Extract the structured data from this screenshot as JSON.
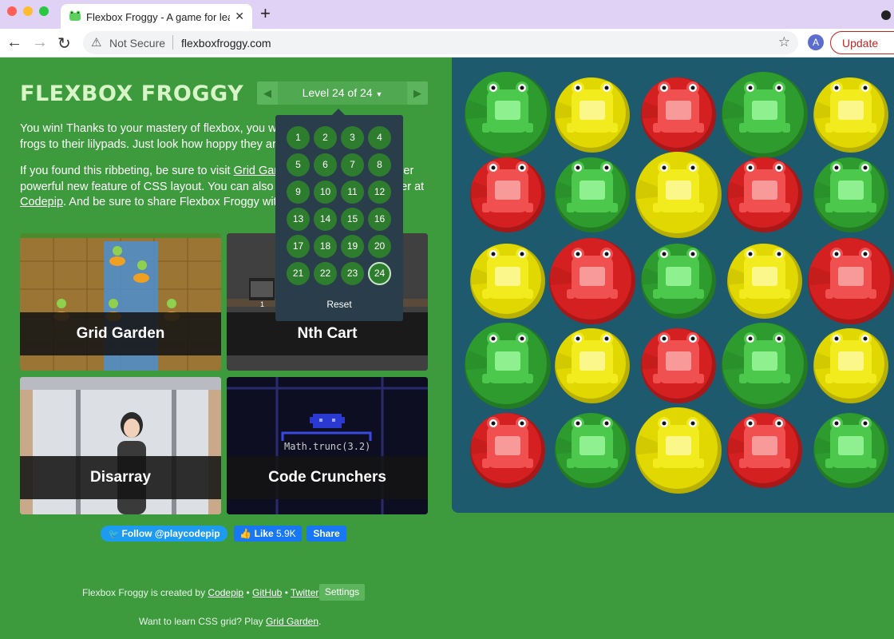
{
  "browser": {
    "tab_title": "Flexbox Froggy - A game for learning CSS flexbox",
    "address_warning": "Not Secure",
    "url": "flexboxfroggy.com",
    "avatar_letter": "A",
    "update_label": "Update"
  },
  "game": {
    "logo": "FLEXBOX FROGGY",
    "level_indicator": "Level 24 of 24",
    "win_text": {
      "p1": "You win! Thanks to your mastery of flexbox, you were able to help all of the frogs to their lilypads. Just look how hoppy they are!",
      "p2_a": "If you found this ribbeting, be sure to visit ",
      "p2_link1": "Grid Garden",
      "p2_b": " to learn about another powerful new feature of CSS layout. You can also find more of our work over at ",
      "p2_link2": "Codepip",
      "p2_c": ". And be sure to share Flexbox Froggy with your friends!"
    },
    "levels": [
      "1",
      "2",
      "3",
      "4",
      "5",
      "6",
      "7",
      "8",
      "9",
      "10",
      "11",
      "12",
      "13",
      "14",
      "15",
      "16",
      "17",
      "18",
      "19",
      "20",
      "21",
      "22",
      "23",
      "24"
    ],
    "current_level": "24",
    "reset_label": "Reset",
    "cards": [
      "Grid Garden",
      "Nth Cart",
      "Disarray",
      "Code Crunchers"
    ],
    "card_sublabels": {
      "cart_number": "1",
      "crunchers_code": "Math.trunc(3.2)"
    },
    "social": {
      "follow": "Follow @playcodepip",
      "like": "Like",
      "like_count": "5.9K",
      "share": "Share"
    },
    "footer": {
      "created_by": "Flexbox Froggy is created by ",
      "codepip": "Codepip",
      "github": "GitHub",
      "twitter": "Twitter",
      "bullet": "•",
      "settings": "Settings",
      "grid_prompt": "Want to learn CSS grid? Play ",
      "grid_link": "Grid Garden",
      "period": "."
    },
    "board_rows": [
      [
        "green",
        "yellow",
        "red",
        "green",
        "yellow"
      ],
      [
        "red",
        "green",
        "yellow",
        "red",
        "green"
      ],
      [
        "yellow",
        "red",
        "green",
        "yellow",
        "red"
      ],
      [
        "green",
        "yellow",
        "red",
        "green",
        "yellow"
      ],
      [
        "red",
        "green",
        "yellow",
        "red",
        "green"
      ]
    ]
  },
  "colors": {
    "page_bg": "#3d9b3d",
    "board_bg": "#1e5a6e",
    "frog_green": "#2e9b2e",
    "frog_yellow": "#e0d800",
    "frog_red": "#d42020"
  }
}
